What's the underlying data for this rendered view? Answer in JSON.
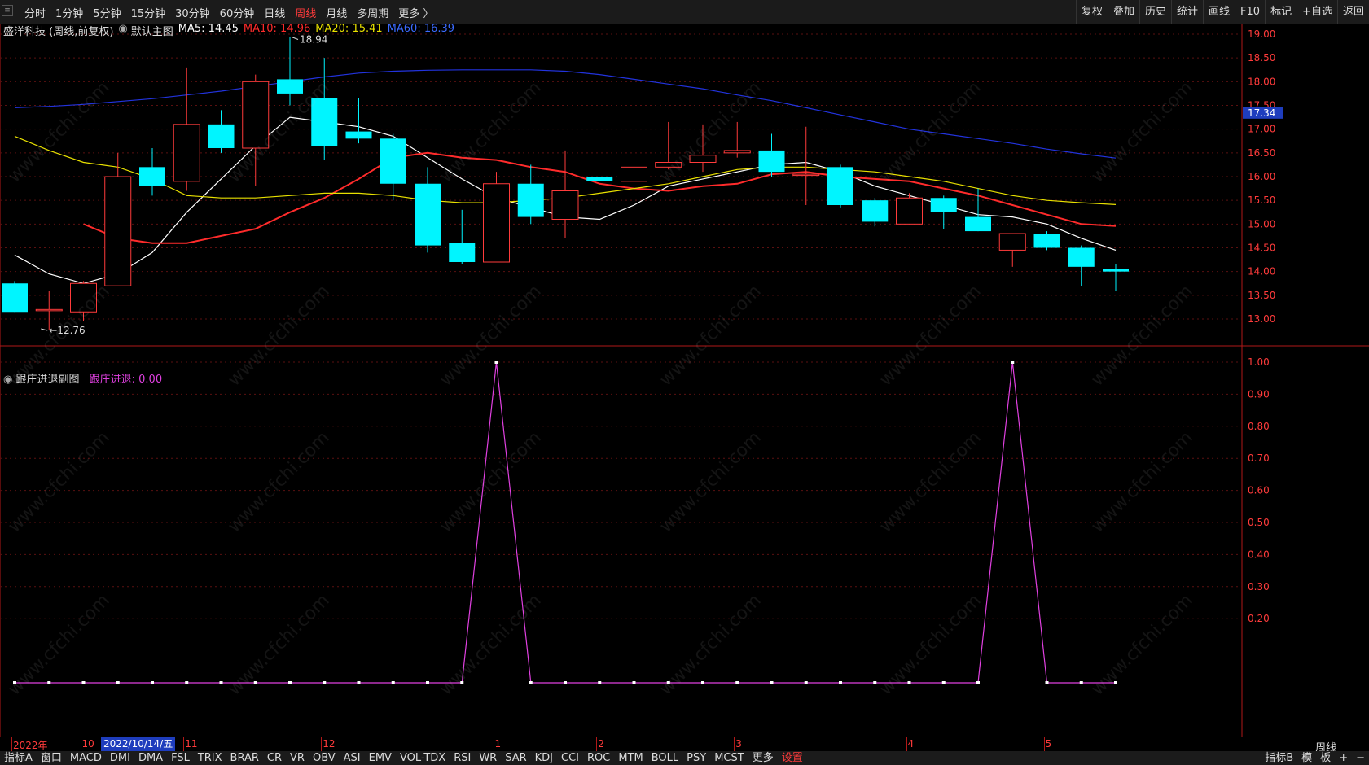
{
  "toolbar": {
    "ctl_icon": "≡",
    "periods": [
      {
        "label": "分时"
      },
      {
        "label": "1分钟"
      },
      {
        "label": "5分钟"
      },
      {
        "label": "15分钟"
      },
      {
        "label": "30分钟"
      },
      {
        "label": "60分钟"
      },
      {
        "label": "日线"
      },
      {
        "label": "周线",
        "active": true
      },
      {
        "label": "月线"
      },
      {
        "label": "多周期"
      },
      {
        "label": "更多 〉"
      }
    ],
    "right": [
      "复权",
      "叠加",
      "历史",
      "统计",
      "画线",
      "F10",
      "标记",
      "+自选",
      "返回"
    ]
  },
  "main_legend": {
    "title": "盛洋科技 (周线,前复权)",
    "mode": "默认主图",
    "ma5": "MA5: 14.45",
    "ma10": "MA10: 14.96",
    "ma20": "MA20: 15.41",
    "ma60": "MA60: 16.39"
  },
  "sub_legend": {
    "name": "跟庄进退副图",
    "value": "跟庄进退: 0.00"
  },
  "chart_data": {
    "type": "candlestick",
    "title": "盛洋科技 (周线,前复权)",
    "price_ticks": [
      "19.00",
      "18.50",
      "18.00",
      "17.50",
      "17.00",
      "16.50",
      "16.00",
      "15.50",
      "15.00",
      "14.50",
      "14.00",
      "13.50",
      "13.00"
    ],
    "price_ylim": [
      12.5,
      19.2
    ],
    "current_price_label": "17.34",
    "high_annotation": "18.94",
    "low_annotation": "12.76",
    "candles": [
      {
        "o": 13.75,
        "h": 13.8,
        "l": 13.15,
        "c": 13.15
      },
      {
        "o": 13.2,
        "h": 13.6,
        "l": 12.76,
        "c": 13.2
      },
      {
        "o": 13.15,
        "h": 13.8,
        "l": 12.95,
        "c": 13.75
      },
      {
        "o": 13.7,
        "h": 16.5,
        "l": 13.7,
        "c": 16.0
      },
      {
        "o": 16.2,
        "h": 16.6,
        "l": 15.6,
        "c": 15.8
      },
      {
        "o": 15.9,
        "h": 18.3,
        "l": 15.7,
        "c": 17.1
      },
      {
        "o": 17.1,
        "h": 17.4,
        "l": 16.5,
        "c": 16.6
      },
      {
        "o": 16.6,
        "h": 18.15,
        "l": 15.8,
        "c": 18.0
      },
      {
        "o": 18.05,
        "h": 18.94,
        "l": 17.5,
        "c": 17.75
      },
      {
        "o": 17.65,
        "h": 18.5,
        "l": 16.35,
        "c": 16.65
      },
      {
        "o": 16.95,
        "h": 17.65,
        "l": 16.7,
        "c": 16.8
      },
      {
        "o": 16.8,
        "h": 16.9,
        "l": 15.5,
        "c": 15.85
      },
      {
        "o": 15.85,
        "h": 16.2,
        "l": 14.4,
        "c": 14.55
      },
      {
        "o": 14.6,
        "h": 15.3,
        "l": 14.15,
        "c": 14.2
      },
      {
        "o": 14.2,
        "h": 16.1,
        "l": 14.2,
        "c": 15.85
      },
      {
        "o": 15.85,
        "h": 16.25,
        "l": 15.0,
        "c": 15.15
      },
      {
        "o": 15.1,
        "h": 16.55,
        "l": 14.7,
        "c": 15.7
      },
      {
        "o": 16.0,
        "h": 16.0,
        "l": 15.9,
        "c": 15.9
      },
      {
        "o": 15.9,
        "h": 16.4,
        "l": 15.8,
        "c": 16.2
      },
      {
        "o": 16.2,
        "h": 17.15,
        "l": 16.15,
        "c": 16.3
      },
      {
        "o": 16.3,
        "h": 17.1,
        "l": 16.1,
        "c": 16.45
      },
      {
        "o": 16.5,
        "h": 17.15,
        "l": 16.4,
        "c": 16.55
      },
      {
        "o": 16.55,
        "h": 16.9,
        "l": 16.0,
        "c": 16.1
      },
      {
        "o": 16.05,
        "h": 17.05,
        "l": 15.4,
        "c": 16.05
      },
      {
        "o": 16.2,
        "h": 16.25,
        "l": 15.35,
        "c": 15.4
      },
      {
        "o": 15.5,
        "h": 15.55,
        "l": 14.95,
        "c": 15.05
      },
      {
        "o": 15.0,
        "h": 15.65,
        "l": 15.0,
        "c": 15.55
      },
      {
        "o": 15.55,
        "h": 15.6,
        "l": 14.9,
        "c": 15.25
      },
      {
        "o": 15.15,
        "h": 15.75,
        "l": 14.85,
        "c": 14.85
      },
      {
        "o": 14.45,
        "h": 14.8,
        "l": 14.1,
        "c": 14.8
      },
      {
        "o": 14.8,
        "h": 14.85,
        "l": 14.45,
        "c": 14.5
      },
      {
        "o": 14.5,
        "h": 14.55,
        "l": 13.7,
        "c": 14.1
      },
      {
        "o": 14.05,
        "h": 14.15,
        "l": 13.6,
        "c": 14.0
      }
    ],
    "ma_series": [
      {
        "name": "MA5",
        "color": "#ffffff",
        "values": [
          14.35,
          13.95,
          13.75,
          13.95,
          14.4,
          15.25,
          15.95,
          16.65,
          17.25,
          17.15,
          17.05,
          16.85,
          16.4,
          15.95,
          15.55,
          15.35,
          15.15,
          15.1,
          15.4,
          15.8,
          15.95,
          16.1,
          16.25,
          16.3,
          16.1,
          15.8,
          15.6,
          15.4,
          15.2,
          15.15,
          15.0,
          14.7,
          14.45
        ]
      },
      {
        "name": "MA10",
        "color": "#ff2b2b",
        "values": [
          null,
          null,
          15.0,
          14.7,
          14.6,
          14.6,
          14.75,
          14.9,
          15.25,
          15.55,
          15.95,
          16.4,
          16.5,
          16.4,
          16.35,
          16.2,
          16.1,
          15.85,
          15.75,
          15.7,
          15.8,
          15.85,
          16.05,
          16.1,
          16.0,
          15.95,
          15.9,
          15.75,
          15.6,
          15.4,
          15.2,
          15.0,
          14.96
        ]
      },
      {
        "name": "MA20",
        "color": "#e8e000",
        "values": [
          16.85,
          16.55,
          16.3,
          16.2,
          15.95,
          15.6,
          15.55,
          15.55,
          15.6,
          15.65,
          15.65,
          15.6,
          15.5,
          15.45,
          15.45,
          15.5,
          15.55,
          15.65,
          15.75,
          15.85,
          16.0,
          16.15,
          16.2,
          16.2,
          16.15,
          16.1,
          16.0,
          15.9,
          15.75,
          15.6,
          15.5,
          15.45,
          15.41
        ]
      },
      {
        "name": "MA60",
        "color": "#2233dd",
        "values": [
          17.45,
          17.48,
          17.52,
          17.58,
          17.64,
          17.72,
          17.8,
          17.9,
          18.0,
          18.1,
          18.18,
          18.22,
          18.24,
          18.25,
          18.25,
          18.25,
          18.22,
          18.15,
          18.05,
          17.95,
          17.85,
          17.72,
          17.6,
          17.45,
          17.3,
          17.15,
          17.0,
          16.9,
          16.8,
          16.7,
          16.58,
          16.48,
          16.39
        ]
      }
    ],
    "sub": {
      "name": "跟庄进退",
      "color": "#e040e0",
      "ylim": [
        0,
        1.0
      ],
      "ticks": [
        "1.00",
        "0.90",
        "0.80",
        "0.70",
        "0.60",
        "0.50",
        "0.40",
        "0.30",
        "0.20"
      ],
      "values": [
        0,
        0,
        0,
        0,
        0,
        0,
        0,
        0,
        0,
        0,
        0,
        0,
        0,
        0,
        1,
        0,
        0,
        0,
        0,
        0,
        0,
        0,
        0,
        0,
        0,
        0,
        0,
        0,
        0,
        1,
        0,
        0,
        0
      ]
    },
    "x_labels": [
      {
        "text": "2022年",
        "index": 0
      },
      {
        "text": "10",
        "index": 2
      },
      {
        "text": "11",
        "index": 5
      },
      {
        "text": "12",
        "index": 9
      },
      {
        "text": "1",
        "index": 14
      },
      {
        "text": "2",
        "index": 17
      },
      {
        "text": "3",
        "index": 21
      },
      {
        "text": "4",
        "index": 26
      },
      {
        "text": "5",
        "index": 30
      }
    ],
    "cursor_date": "2022/10/14/五"
  },
  "period_label": "周线",
  "bottombar": {
    "items": [
      "指标A",
      "窗口",
      "MACD",
      "DMI",
      "DMA",
      "FSL",
      "TRIX",
      "BRAR",
      "CR",
      "VR",
      "OBV",
      "ASI",
      "EMV",
      "VOL-TDX",
      "RSI",
      "WR",
      "SAR",
      "KDJ",
      "CCI",
      "ROC",
      "MTM",
      "BOLL",
      "PSY",
      "MCST",
      "更多",
      "设置"
    ],
    "right": [
      "指标B",
      "模",
      "板",
      "+",
      "−"
    ]
  },
  "watermark_text": "www.cfchi.com"
}
